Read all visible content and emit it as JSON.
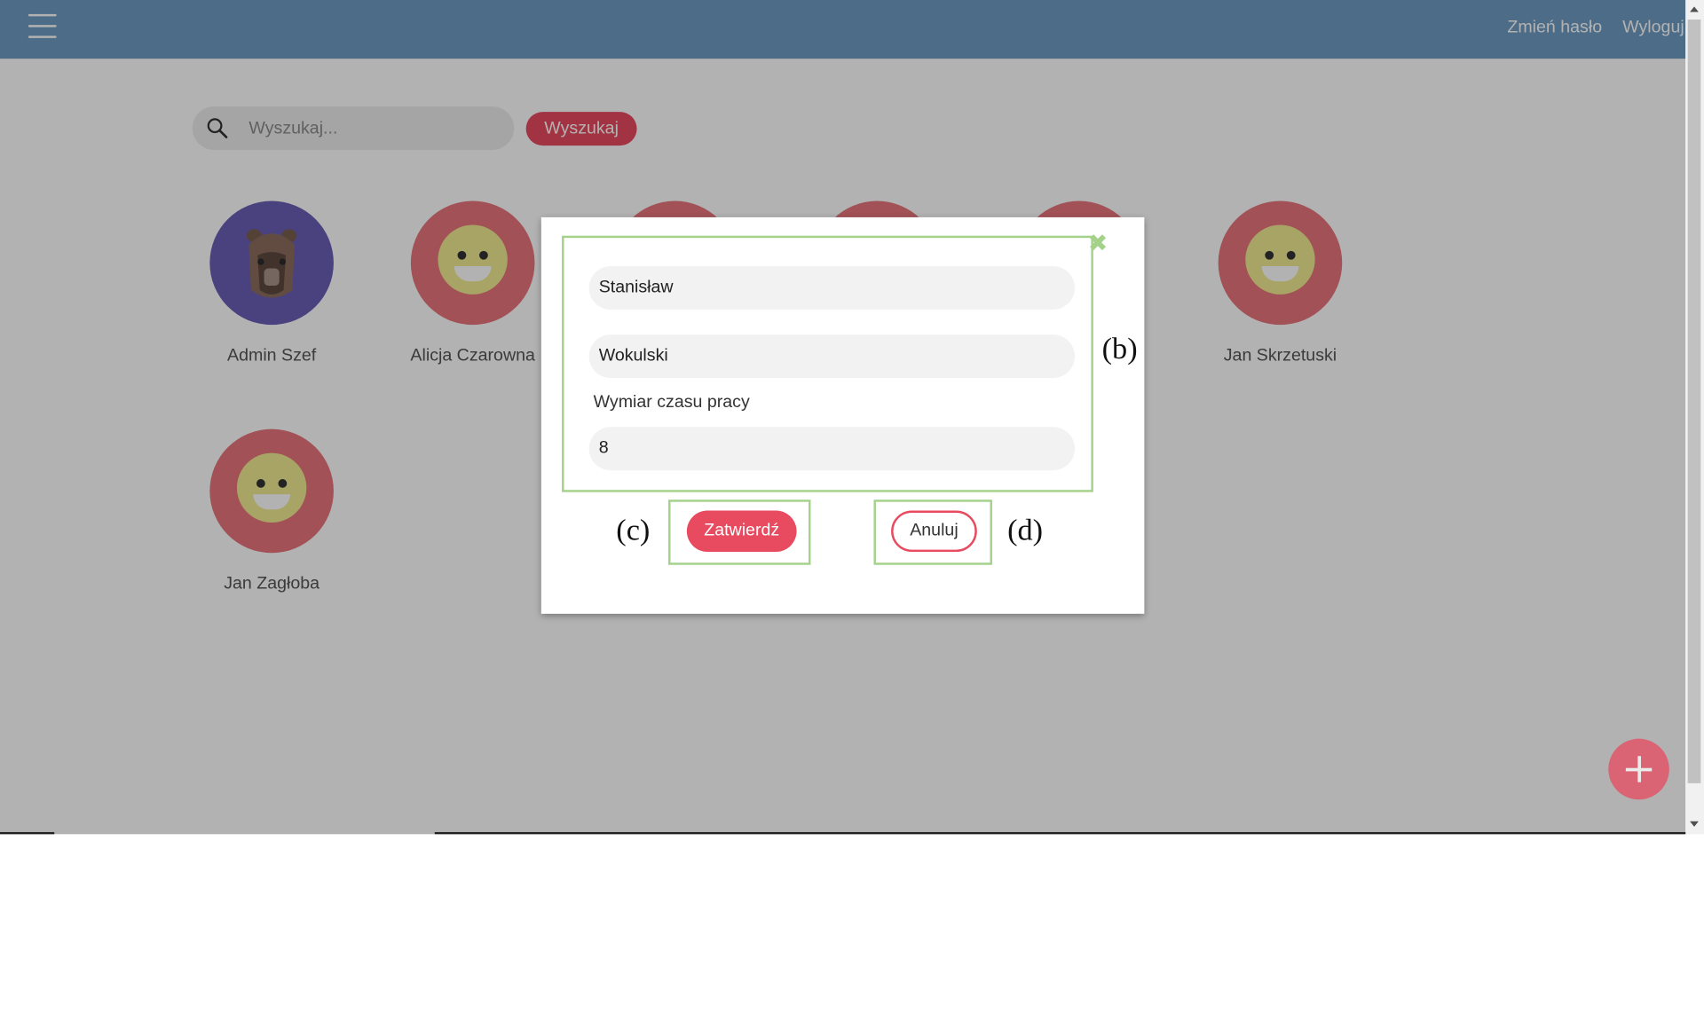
{
  "header": {
    "change_password": "Zmień hasło",
    "logout": "Wyloguj"
  },
  "search": {
    "placeholder": "Wyszukaj...",
    "button": "Wyszukaj"
  },
  "users": [
    {
      "name": "Admin Szef",
      "avatar": "capybara"
    },
    {
      "name": "Alicja Czarowna",
      "avatar": "smiley"
    },
    {
      "name": "Jan Skrzetuski",
      "avatar": "smiley"
    },
    {
      "name": "Jan Zagłoba",
      "avatar": "smiley"
    }
  ],
  "modal": {
    "first_name": "Stanisław",
    "last_name": "Wokulski",
    "work_time_label": "Wymiar czasu pracy",
    "work_time_value": "8",
    "confirm": "Zatwierdź",
    "cancel": "Anuluj",
    "close_symbol": "✖"
  },
  "annotations": {
    "b": "(b)",
    "c": "(c)",
    "d": "(d)"
  },
  "colors": {
    "topbar": "#6d9bc3",
    "accent": "#e84a5f",
    "annotation_box": "#a4d28a"
  }
}
